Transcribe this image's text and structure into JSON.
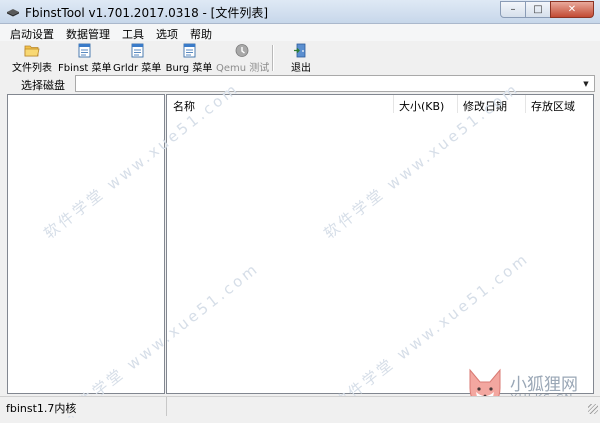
{
  "window": {
    "title": "FbinstTool v1.701.2017.0318 - [文件列表]",
    "controls": {
      "minimize": "–",
      "maximize": "□",
      "close": "✕"
    }
  },
  "menu": [
    "启动设置",
    "数据管理",
    "工具",
    "选项",
    "帮助"
  ],
  "toolbar": {
    "items": [
      {
        "label": "文件列表",
        "icon": "folder-icon",
        "enabled": true
      },
      {
        "label": "Fbinst 菜单",
        "icon": "menu-doc-icon",
        "enabled": true
      },
      {
        "label": "Grldr 菜单",
        "icon": "menu-doc-icon",
        "enabled": true
      },
      {
        "label": "Burg 菜单",
        "icon": "menu-doc-icon",
        "enabled": true
      },
      {
        "label": "Qemu 测试",
        "icon": "qemu-icon",
        "enabled": false
      },
      {
        "label": "退出",
        "icon": "exit-door-icon",
        "enabled": true
      }
    ]
  },
  "disk": {
    "label": "选择磁盘",
    "selected": ""
  },
  "file_list": {
    "columns": [
      "名称",
      "大小(KB)",
      "修改日期",
      "存放区域"
    ],
    "rows": []
  },
  "status": {
    "text": "fbinst1.7内核"
  },
  "watermark": {
    "text": "软件学堂 www.xue51.com",
    "logo_title": "小狐狸网",
    "logo_subtitle": "XHLKS.CN"
  },
  "colors": {
    "accent": "#1e6fc2",
    "close_button": "#c24a33",
    "watermark": "#d6dee8"
  }
}
